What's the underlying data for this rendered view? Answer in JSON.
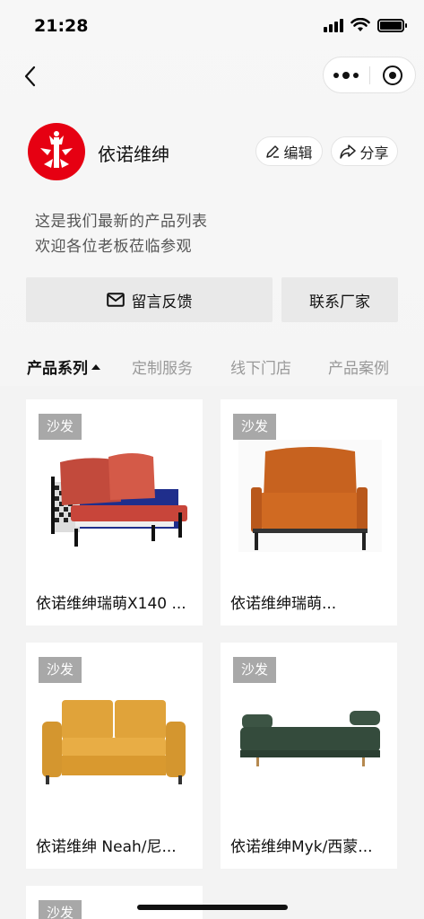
{
  "status_bar": {
    "time": "21:28"
  },
  "profile": {
    "store_name": "依诺维绅",
    "edit_label": "编辑",
    "share_label": "分享",
    "description_lines": [
      "这是我们最新的产品列表",
      "欢迎各位老板莅临参观"
    ]
  },
  "actions": {
    "message_label": "留言反馈",
    "contact_label": "联系厂家"
  },
  "tabs": [
    {
      "label": "产品系列",
      "active": true
    },
    {
      "label": "定制服务",
      "active": false
    },
    {
      "label": "线下门店",
      "active": false
    },
    {
      "label": "产品案例",
      "active": false
    }
  ],
  "products": [
    {
      "tag": "沙发",
      "title": "依诺维绅瑞萌X140 ...",
      "image": "sofa-red-blue"
    },
    {
      "tag": "沙发",
      "title": "依诺维绅瑞萌...",
      "image": "armchair-orange"
    },
    {
      "tag": "沙发",
      "title": "依诺维绅 Neah/尼...",
      "image": "sofa-yellow"
    },
    {
      "tag": "沙发",
      "title": "依诺维绅Myk/西蒙...",
      "image": "daybed-green"
    },
    {
      "tag": "沙发"
    }
  ],
  "colors": {
    "logo_red": "#e60012",
    "tag_grey": "#a8a8a8",
    "button_grey": "#e9e9e9"
  }
}
